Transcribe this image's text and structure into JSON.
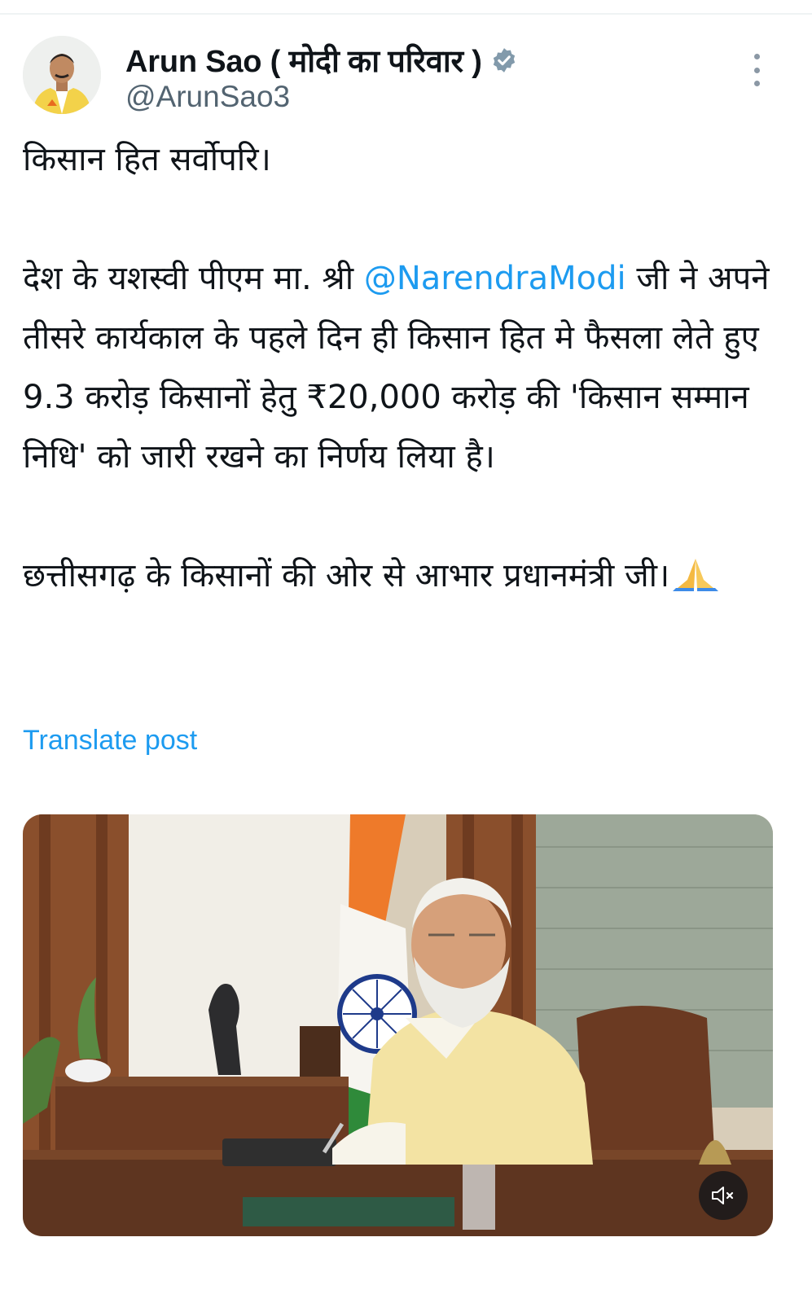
{
  "post": {
    "author": {
      "display_name": "Arun Sao ( मोदी का परिवार )",
      "handle": "@ArunSao3",
      "verified": true
    },
    "text": {
      "line1": "किसान हित सर्वोपरि।",
      "para2_before_mention": "देश के यशस्वी पीएम मा. श्री ",
      "mention": "@NarendraModi",
      "para2_after_mention": " जी ने अपने तीसरे कार्यकाल के पहले दिन ही किसान हित मे फैसला लेते हुए 9.3 करोड़ किसानों हेतु ₹20,000 करोड़ की 'किसान सम्मान निधि' को जारी रखने का निर्णय लिया है।",
      "para3": "छत्तीसगढ़ के किसानों की ओर से आभार प्रधानमंत्री जी।"
    },
    "translate_label": "Translate post",
    "media": {
      "type": "video",
      "muted": true
    }
  },
  "colors": {
    "link": "#1d9bf0",
    "text": "#0f1419",
    "secondary": "#536471",
    "verified_badge": "#829aab"
  },
  "icons": {
    "verified": "verified-badge-icon",
    "more": "more-vertical-icon",
    "emoji": "folded-hands-emoji",
    "mute": "speaker-muted-icon"
  }
}
